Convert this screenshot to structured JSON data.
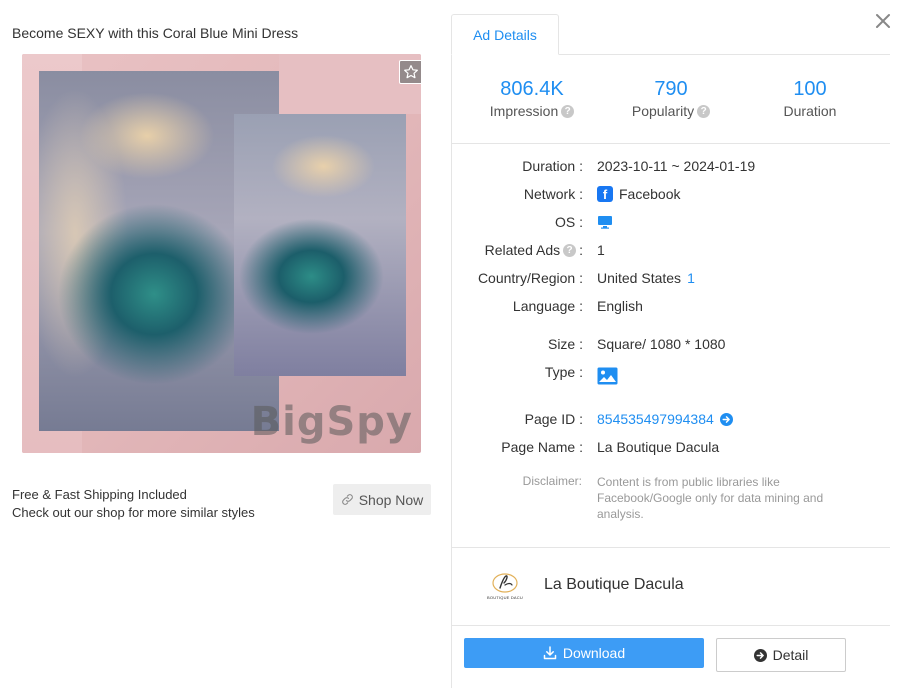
{
  "ad": {
    "title": "Become SEXY with this Coral Blue Mini Dress",
    "watermark": "BigSpy",
    "caption_line1": "Free & Fast Shipping Included",
    "caption_line2": "Check out our shop for more similar styles",
    "cta_label": "Shop Now"
  },
  "panel": {
    "tab_label": "Ad Details",
    "stats": [
      {
        "value": "806.4K",
        "label": "Impression"
      },
      {
        "value": "790",
        "label": "Popularity"
      },
      {
        "value": "100",
        "label": "Duration"
      }
    ],
    "details": {
      "duration_label": "Duration :",
      "duration_value": "2023-10-11 ~ 2024-01-19",
      "network_label": "Network :",
      "network_value": "Facebook",
      "os_label": "OS :",
      "related_label": "Related Ads",
      "related_sep": ":",
      "related_value": "1",
      "country_label": "Country/Region :",
      "country_value": "United States",
      "country_count": "1",
      "language_label": "Language :",
      "language_value": "English",
      "size_label": "Size :",
      "size_value": "Square/ 1080 * 1080",
      "type_label": "Type :",
      "page_id_label": "Page ID :",
      "page_id_value": "854535497994384",
      "page_name_label": "Page Name :",
      "page_name_value": "La Boutique Dacula",
      "disclaimer_label": "Disclaimer:",
      "disclaimer_value": "Content is from public libraries like Facebook/Google only for data mining and analysis."
    },
    "brand": {
      "name": "La Boutique Dacula",
      "logo_text": "BOUTIQUE DACU"
    },
    "download_label": "Download",
    "detail_label": "Detail"
  },
  "colors": {
    "accent": "#1f8ef1",
    "download_bg": "#3d9cf5",
    "facebook": "#1877f2"
  },
  "icons": [
    "star-icon",
    "link-icon",
    "close-icon",
    "help-icon",
    "facebook-icon",
    "monitor-icon",
    "image-icon",
    "arrow-right-circle-icon",
    "download-icon"
  ]
}
